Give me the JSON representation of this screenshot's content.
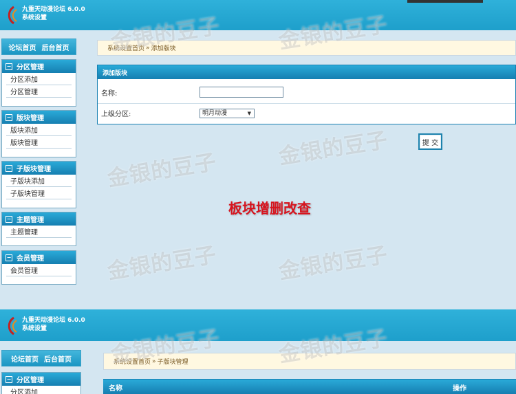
{
  "app": {
    "title_line1": "九重天动漫论坛 6.0.0",
    "title_line2": "系统设置"
  },
  "sidebar": {
    "links": [
      "论坛首页",
      "后台首页"
    ],
    "sections": [
      {
        "label": "分区管理",
        "items": [
          "分区添加",
          "分区管理"
        ]
      },
      {
        "label": "版块管理",
        "items": [
          "版块添加",
          "版块管理"
        ]
      },
      {
        "label": "子版块管理",
        "items": [
          "子版块添加",
          "子版块管理"
        ]
      },
      {
        "label": "主题管理",
        "items": [
          "主题管理"
        ]
      },
      {
        "label": "会员管理",
        "items": [
          "会员管理"
        ]
      }
    ]
  },
  "screen1": {
    "breadcrumb": [
      "系统设置首页",
      "添加版块"
    ],
    "panel_title": "添加版块",
    "name_label": "名称:",
    "name_value": "",
    "parent_label": "上级分区:",
    "parent_value": "明月动漫",
    "submit_label": "提 交",
    "caption": "板块增删改查"
  },
  "screen2": {
    "breadcrumb": [
      "系统设置首页",
      "子版块管理"
    ],
    "first_menu_label": "分区管理",
    "first_menu_item_partial": "分区添加",
    "table_headers": [
      "名称",
      "操作"
    ]
  },
  "watermark_text": "金银的豆子",
  "colors": {
    "accent": "#1e9fcb",
    "background": "#d4e6f1",
    "caption": "#d7141e"
  }
}
